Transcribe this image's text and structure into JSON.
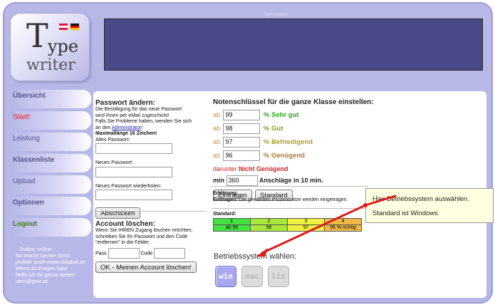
{
  "logo": {
    "letter_t": "T",
    "ype": "ype",
    "writer": "writer"
  },
  "banner": {
    "sponsor_label": "Sponsoren"
  },
  "nav": {
    "items": [
      {
        "label": "Übersicht"
      },
      {
        "label": "Start!"
      },
      {
        "label": "Leistung"
      },
      {
        "label": "Klassenliste"
      },
      {
        "label": "Upload"
      },
      {
        "label": "Optionen"
      },
      {
        "label": "Logout"
      }
    ]
  },
  "status": {
    "label": "Status: online",
    "line1": "So macht Lernen Sinn!",
    "line2": "probier auch www.vokabel.at!",
    "line3": "Wenn du Fragen hast",
    "line4": "helfe ich dir gerne weiter!",
    "line5": "oem@gmx.at"
  },
  "password": {
    "title": "Passwort ändern:",
    "desc1": "Die Bestätigung für das neue Passwort",
    "desc2": "wird Ihnen per eMail zugeschickt!",
    "desc3": "Falls Sie Probleme haben, wenden Sie sich",
    "desc4_prefix": "an den ",
    "desc4_link": "Administrator",
    "desc4_suffix": "!",
    "maxlen": "Maximallänge 16 Zeichen!",
    "old_label": "Altes Passwort:",
    "new_label": "Neues Passwort:",
    "repeat_label": "Neues Passwort wiederholen:",
    "submit": "Abschicken"
  },
  "account": {
    "title": "Account löschen:",
    "desc1": "Wenn Sie IHREN Zugang löschen möchten,",
    "desc2": "schreiben Sie Ihr Passwort und den Code",
    "desc3": "\"entfernen\" in die Felder.",
    "pass_label": "Pass",
    "code_label": "Code",
    "delete_button": "OK - Meinen Account löschen!"
  },
  "grades": {
    "title": "Notenschlüssel für die ganze Klasse einstellen:",
    "ab": "ab",
    "rows": [
      {
        "value": "99",
        "label": "% Sehr gut"
      },
      {
        "value": "98",
        "label": "% Gut"
      },
      {
        "value": "97",
        "label": "% Befriedigend"
      },
      {
        "value": "96",
        "label": "% Genügend"
      }
    ],
    "below_prefix": "darunter ",
    "below_bold": "Nicht Genügend",
    "min_label": "min",
    "min_value": "360",
    "min_suffix": "Anschläge in 10 min.",
    "btn_submit": "Eintragen",
    "btn_standard": "Standard"
  },
  "explain": {
    "title": "Erklärung:",
    "line_bold": "Eintragen:",
    "line_rest": " Die gewählten Prozentsätze werden eingetragen."
  },
  "standard": {
    "title": "Standard:",
    "headers": [
      "1",
      "2",
      "3",
      "4"
    ],
    "values": [
      "ab 99",
      "98",
      "97",
      "96 % richtig"
    ]
  },
  "os": {
    "title": "Betriebssystem wählen:",
    "options": [
      "win",
      "mac",
      "lin"
    ]
  },
  "tooltip": {
    "line1": "Hier Betriebssystem auswählen.",
    "line2": "Standard ist Windows"
  },
  "colors": {
    "frame": "#b8b8e8",
    "banner": "#4a4a8a",
    "tooltip_bg": "#ffffe1",
    "arrow": "#e01818"
  }
}
